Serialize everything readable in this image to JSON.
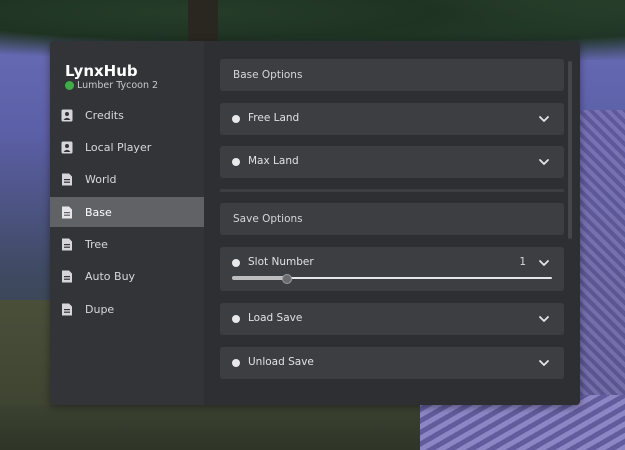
{
  "app": {
    "title": "LynxHub",
    "subtitle": "Lumber Tycoon 2",
    "status_color": "#3fae49"
  },
  "sidebar": {
    "items": [
      {
        "label": "Credits",
        "icon": "person-card-icon",
        "active": false
      },
      {
        "label": "Local Player",
        "icon": "person-card-icon",
        "active": false
      },
      {
        "label": "World",
        "icon": "document-icon",
        "active": false
      },
      {
        "label": "Base",
        "icon": "document-icon",
        "active": true
      },
      {
        "label": "Tree",
        "icon": "document-icon",
        "active": false
      },
      {
        "label": "Auto Buy",
        "icon": "document-icon",
        "active": false
      },
      {
        "label": "Dupe",
        "icon": "document-icon",
        "active": false
      }
    ]
  },
  "main": {
    "sections": [
      {
        "header": "Base Options",
        "items": [
          {
            "label": "Free Land",
            "type": "dropdown"
          },
          {
            "label": "Max Land",
            "type": "dropdown"
          }
        ]
      },
      {
        "header": "Save Options",
        "items": [
          {
            "label": "Slot Number",
            "type": "slider",
            "value": "1",
            "level": 0.17
          },
          {
            "label": "Load Save",
            "type": "dropdown"
          },
          {
            "label": "Unload Save",
            "type": "dropdown"
          }
        ]
      }
    ]
  },
  "colors": {
    "window_bg": "#2e2f32",
    "sidebar_bg": "#333438",
    "row_bg": "#3d3e42",
    "active_tab_bg": "#616266"
  }
}
